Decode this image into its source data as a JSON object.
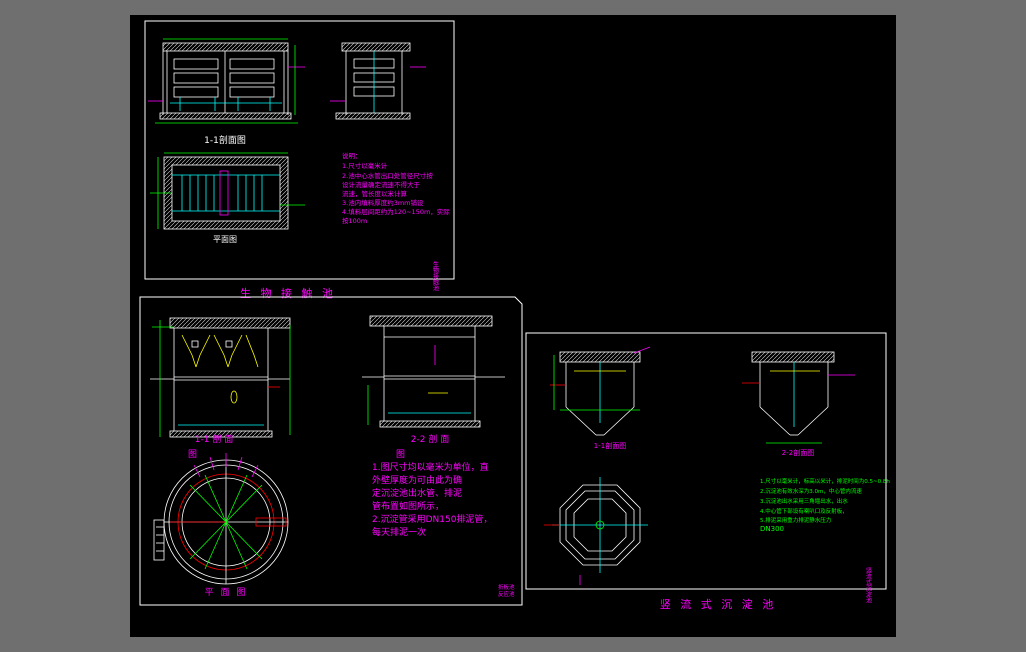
{
  "colors": {
    "background": "#000000",
    "frame": "#ffffff",
    "title": "#ff00ff",
    "notes": "#ff00ff",
    "notes_alt": "#00ff00",
    "structure": "#ffffff",
    "pipe": "#00ffff",
    "dimension": "#00ff00",
    "annotation": "#ff0000",
    "hatch": "#ffff00"
  },
  "sheet1": {
    "title": "生 物 接 触 池",
    "view_section": "1-1剖面图",
    "view_plan": "平面图",
    "notes": [
      "说明：",
      "1.尺寸以毫米计",
      "2.池中心水管出口处管径尺寸按",
      "设计流量确定流速不得大于",
      "流速，管长度以米计算",
      "3.池内填料厚度约3mm铺设",
      "4.填料层间距约为120~150m，实际",
      "按100m"
    ],
    "side_label": "生物接触池"
  },
  "sheet2": {
    "view_section_1": "1-1 剖 面",
    "view_section_2": "2-2 剖 面",
    "view_plan": "平 面 图",
    "sub_label": "图",
    "notes": [
      "1.图尺寸均以毫米为单位，直",
      "外壁厚度为可由此为确",
      "定沉淀池出水管、排泥",
      "管布置如图所示，",
      "2.沉淀管采用DN150排泥管，",
      "每天排泥一次"
    ],
    "corner_label_1": "折板池",
    "corner_label_2": "反应池"
  },
  "sheet3": {
    "title": "竖 流 式 沉 淀 池",
    "view_section_1": "1-1剖面图",
    "view_section_2": "2-2剖面图",
    "notes": [
      "1.尺寸以毫米计，标高以米计，排泥时间为0.5~0.8h",
      "2.沉淀池有效水深为3.0m，中心管内流速",
      "3.沉淀池出水采用三角堰出水，出水",
      "4.中心管下部设有喇叭口及反射板，",
      "5.排泥采用重力排泥静水压力",
      "DN300"
    ],
    "side_label": "竖流式沉淀池"
  }
}
